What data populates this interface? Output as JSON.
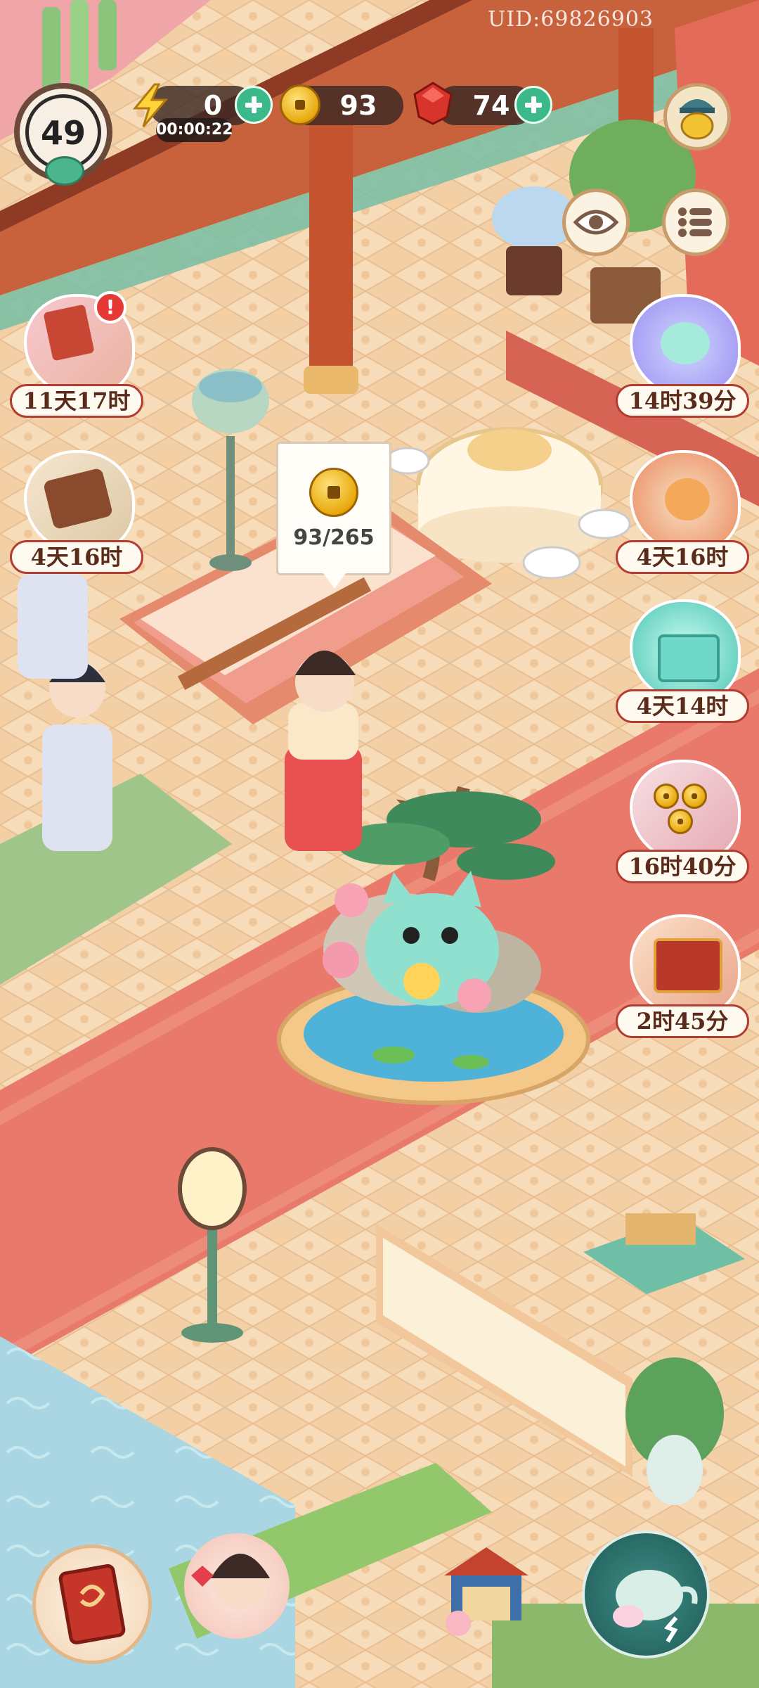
{
  "hud": {
    "uid": "UID:69826903",
    "level": "49",
    "energy": {
      "value": "0",
      "timer": "00:00:22"
    },
    "coins": "93",
    "gems": "74"
  },
  "coin_bubble": {
    "progress": "93/265",
    "fraction": 0.351
  },
  "events_left": [
    {
      "timer": "11天17时",
      "has_alert": true,
      "icon": "scroll-flowers-icon"
    },
    {
      "timer": "4天16时",
      "has_alert": false,
      "icon": "lotus-box-icon"
    }
  ],
  "events_right": [
    {
      "timer": "14时39分",
      "icon": "spirit-cat-icon"
    },
    {
      "timer": "4天16时",
      "icon": "fan-cat-icon"
    },
    {
      "timer": "4天14时",
      "icon": "gift-cat-icon"
    },
    {
      "timer": "16时40分",
      "icon": "coin-cards-icon"
    },
    {
      "timer": "2时45分",
      "icon": "treasure-chest-icon"
    }
  ],
  "bottom_bar": [
    {
      "icon": "book-icon"
    },
    {
      "icon": "character-portrait-icon"
    },
    {
      "icon": "shop-pavilion-icon"
    },
    {
      "icon": "teapot-icon"
    }
  ],
  "top_right": [
    {
      "icon": "treasure-pot-icon"
    },
    {
      "icon": "eye-icon"
    },
    {
      "icon": "list-menu-icon"
    }
  ],
  "colors": {
    "carpet": "#e9796b",
    "floor": "#f2cfa6",
    "wood": "#b5532f",
    "hud_bg": "#3c2823",
    "plus_green": "#3cb98a",
    "gem_red": "#d8342c"
  }
}
